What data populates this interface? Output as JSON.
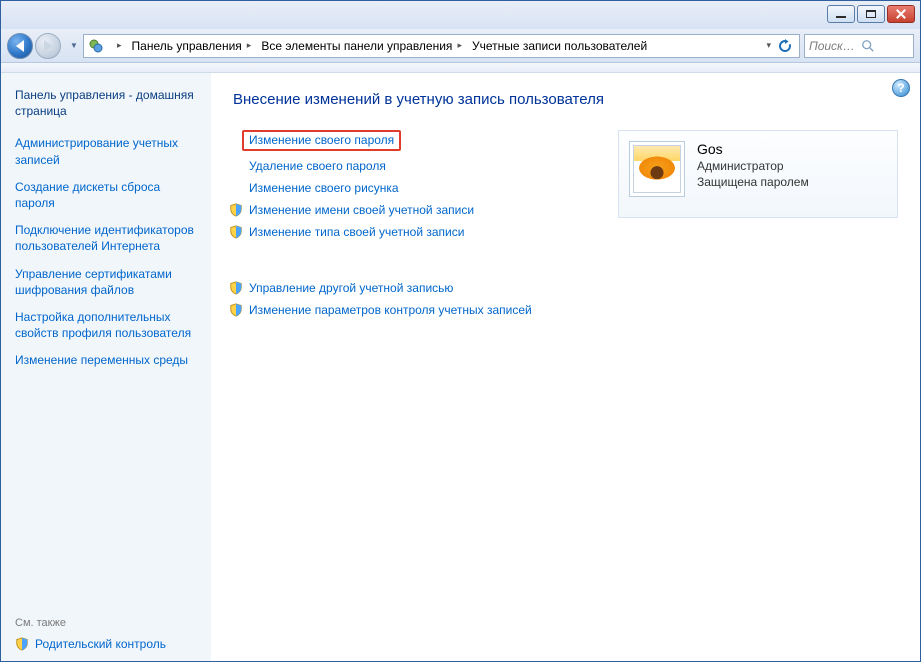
{
  "breadcrumbs": {
    "0": "Панель управления",
    "1": "Все элементы панели управления",
    "2": "Учетные записи пользователей"
  },
  "search": {
    "placeholder": "Поиск в па..."
  },
  "sidebar": {
    "home": "Панель управления - домашняя страница",
    "links": {
      "0": "Администрирование учетных записей",
      "1": "Создание дискеты сброса пароля",
      "2": "Подключение идентификаторов пользователей Интернета",
      "3": "Управление сертификатами шифрования файлов",
      "4": "Настройка дополнительных свойств профиля пользователя",
      "5": "Изменение переменных среды"
    },
    "see_also": "См. также",
    "footer": "Родительский контроль"
  },
  "page": {
    "title": "Внесение изменений в учетную запись пользователя",
    "actions": {
      "change_password": "Изменение своего пароля",
      "remove_password": "Удаление своего пароля",
      "change_picture": "Изменение своего рисунка",
      "change_name": "Изменение имени своей учетной записи",
      "change_type": "Изменение типа своей учетной записи",
      "manage_other": "Управление другой учетной записью",
      "uac_settings": "Изменение параметров контроля учетных записей"
    }
  },
  "account": {
    "name": "Gos",
    "role": "Администратор",
    "protection": "Защищена паролем"
  },
  "help": {
    "glyph": "?"
  }
}
